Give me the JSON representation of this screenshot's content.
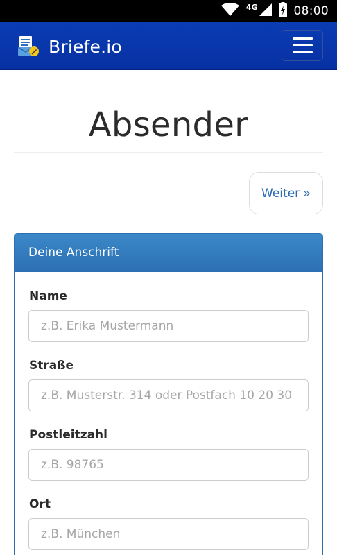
{
  "status_bar": {
    "network": "4G",
    "time": "08:00"
  },
  "navbar": {
    "brand": "Briefe.io",
    "menu_icon": "hamburger-menu-icon"
  },
  "page": {
    "title": "Absender",
    "next_button": "Weiter »"
  },
  "panel": {
    "heading": "Deine Anschrift",
    "fields": [
      {
        "label": "Name",
        "placeholder": "z.B. Erika Mustermann",
        "value": ""
      },
      {
        "label": "Straße",
        "placeholder": "z.B. Musterstr. 314 oder Postfach 10 20 30",
        "value": ""
      },
      {
        "label": "Postleitzahl",
        "placeholder": "z.B. 98765",
        "value": ""
      },
      {
        "label": "Ort",
        "placeholder": "z.B. München",
        "value": ""
      }
    ]
  },
  "colors": {
    "navbar": "#0a3cb4",
    "panel_heading": "#337ab7",
    "link": "#2a6ab3"
  }
}
